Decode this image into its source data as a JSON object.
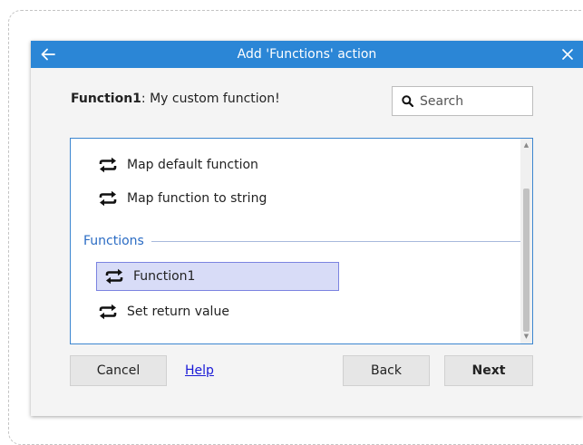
{
  "window": {
    "title": "Add 'Functions' action",
    "back_icon": "arrow-left-icon",
    "close_icon": "close-icon",
    "accent": "#2b86d6"
  },
  "header": {
    "name": "Function1",
    "description": ": My custom function!"
  },
  "search": {
    "placeholder": "Search",
    "icon": "search-icon"
  },
  "list": {
    "items_top": [
      {
        "label": "Map default function",
        "icon": "repeat-icon"
      },
      {
        "label": "Map function to string",
        "icon": "repeat-icon"
      }
    ],
    "group": {
      "label": "Functions",
      "items": [
        {
          "label": "Function1",
          "icon": "repeat-icon",
          "selected": true
        },
        {
          "label": "Set return value",
          "icon": "repeat-icon",
          "selected": false
        }
      ]
    },
    "selection_color": "#d8dcf7"
  },
  "footer": {
    "cancel_label": "Cancel",
    "help_label": "Help",
    "back_label": "Back",
    "next_label": "Next"
  }
}
